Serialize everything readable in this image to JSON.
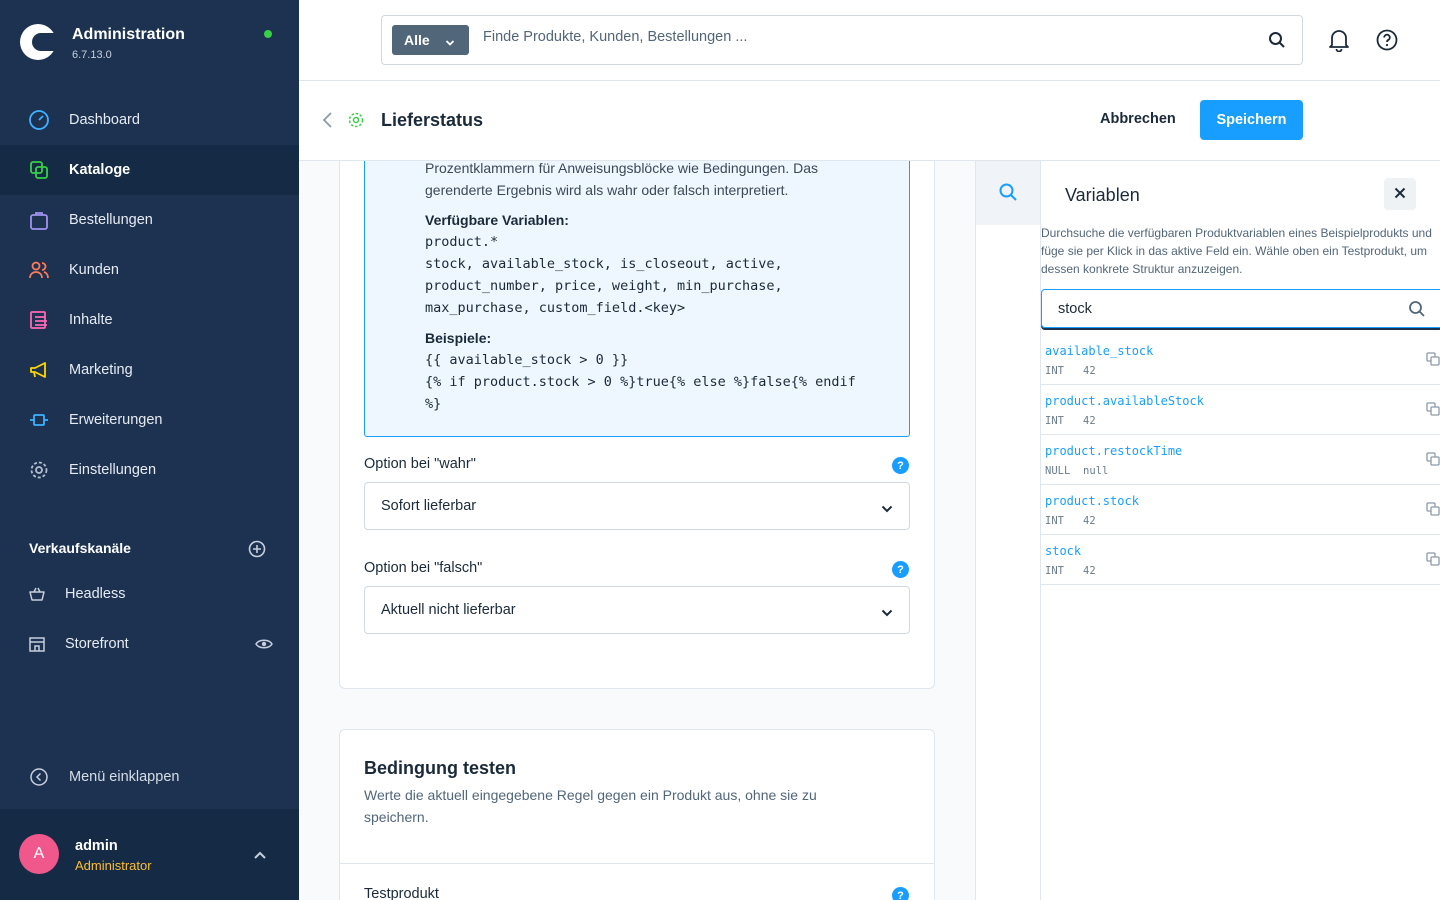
{
  "brand": {
    "title": "Administration",
    "version": "6.7.13.0"
  },
  "nav": {
    "items": [
      {
        "label": "Dashboard",
        "icon": "dashboard-icon"
      },
      {
        "label": "Kataloge",
        "icon": "catalog-icon",
        "active": true
      },
      {
        "label": "Bestellungen",
        "icon": "shopping-bag-icon"
      },
      {
        "label": "Kunden",
        "icon": "users-icon"
      },
      {
        "label": "Inhalte",
        "icon": "content-icon"
      },
      {
        "label": "Marketing",
        "icon": "megaphone-icon"
      },
      {
        "label": "Erweiterungen",
        "icon": "plug-icon"
      },
      {
        "label": "Einstellungen",
        "icon": "gear-icon"
      }
    ]
  },
  "sales_channels": {
    "title": "Verkaufskanäle",
    "items": [
      {
        "label": "Headless",
        "icon": "basket-icon"
      },
      {
        "label": "Storefront",
        "icon": "storefront-icon"
      }
    ]
  },
  "collapse_label": "Menü einklappen",
  "user": {
    "initial": "A",
    "name": "admin",
    "role": "Administrator"
  },
  "search": {
    "type_label": "Alle",
    "placeholder": "Finde Produkte, Kunden, Bestellungen ..."
  },
  "smartbar": {
    "title": "Lieferstatus",
    "cancel": "Abbrechen",
    "save": "Speichern"
  },
  "help_box": {
    "line1": "Prozentklammern für Anweisungsblöcke wie Bedingungen. Das",
    "line2": "gerenderte Ergebnis wird als wahr oder falsch interpretiert.",
    "vars_title": "Verfügbare Variablen:",
    "vars_lines": [
      "product.*",
      "stock, available_stock, is_closeout, active,",
      "product_number, price, weight, min_purchase,",
      "max_purchase, custom_field.<key>"
    ],
    "examples_title": "Beispiele:",
    "examples_lines": [
      "{{ available_stock > 0 }}",
      "{% if product.stock > 0 %}true{% else %}false{% endif",
      "%}"
    ]
  },
  "option_true": {
    "label": "Option bei \"wahr\"",
    "value": "Sofort lieferbar",
    "help": "?"
  },
  "option_false": {
    "label": "Option bei \"falsch\"",
    "value": "Aktuell nicht lieferbar",
    "help": "?"
  },
  "test_card": {
    "title": "Bedingung testen",
    "subtitle": "Werte die aktuell eingegebene Regel gegen ein Produkt aus, ohne sie zu speichern.",
    "field_label": "Testprodukt",
    "help": "?"
  },
  "variables_panel": {
    "title": "Variablen",
    "description": "Durchsuche die verfügbaren Produktvariablen eines Beispielprodukts und füge sie per Klick in das aktive Feld ein. Wähle oben ein Testprodukt, um dessen konkrete Struktur anzuzeigen.",
    "search_value": "stock",
    "items": [
      {
        "name": "available_stock",
        "type": "INT",
        "value": "42"
      },
      {
        "name": "product.availableStock",
        "type": "INT",
        "value": "42"
      },
      {
        "name": "product.restockTime",
        "type": "NULL",
        "value": "null"
      },
      {
        "name": "product.stock",
        "type": "INT",
        "value": "42"
      },
      {
        "name": "stock",
        "type": "INT",
        "value": "42"
      }
    ]
  },
  "colors": {
    "sidebar": "#1d3251",
    "accent": "#189eff",
    "online": "#37d046",
    "avatar": "#f0588b",
    "role": "#ffbd2e"
  }
}
